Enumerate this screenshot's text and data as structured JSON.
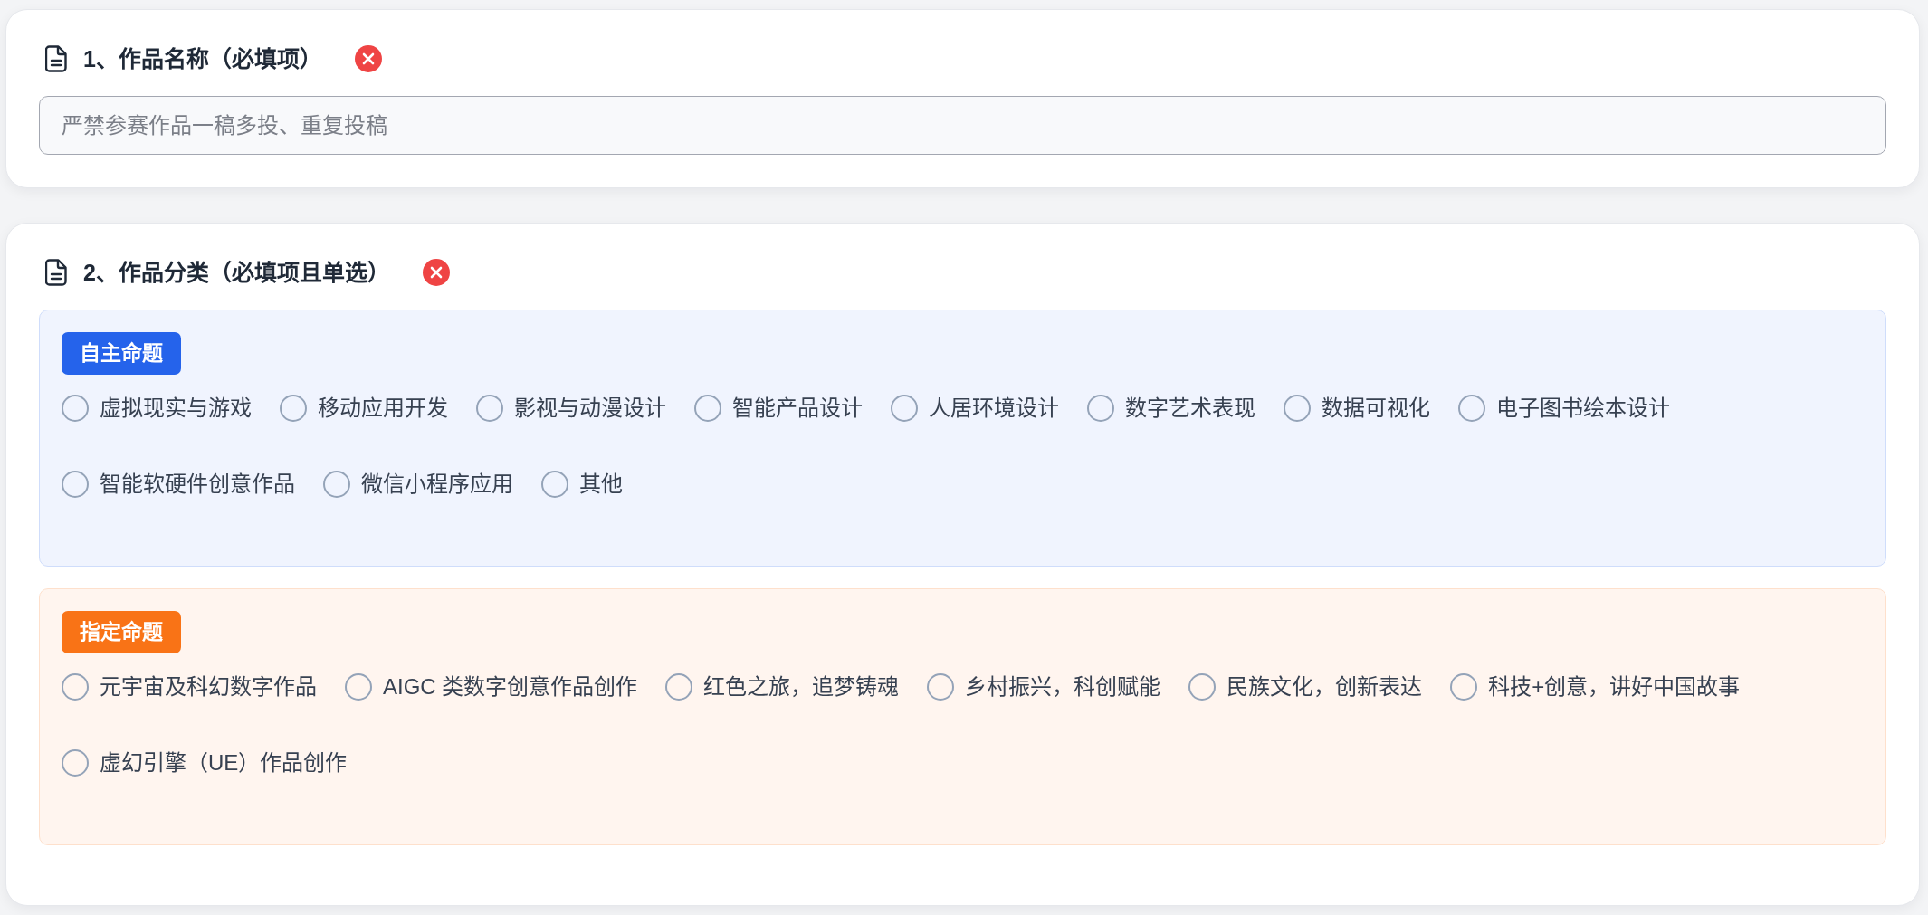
{
  "questions": [
    {
      "title": "1、作品名称（必填项）",
      "invalid": true,
      "kind": "text",
      "placeholder": "严禁参赛作品一稿多投、重复投稿"
    },
    {
      "title": "2、作品分类（必填项且单选）",
      "invalid": true,
      "kind": "radio_groups",
      "groups": [
        {
          "tag": "自主命题",
          "color": "#2563eb",
          "options": [
            {
              "label": "虚拟现实与游戏",
              "selected": false
            },
            {
              "label": "移动应用开发",
              "selected": false
            },
            {
              "label": "影视与动漫设计",
              "selected": false
            },
            {
              "label": "智能产品设计",
              "selected": false
            },
            {
              "label": "人居环境设计",
              "selected": false
            },
            {
              "label": "数字艺术表现",
              "selected": false
            },
            {
              "label": "数据可视化",
              "selected": false
            },
            {
              "label": "电子图书绘本设计",
              "selected": false
            },
            {
              "label": "智能软硬件创意作品",
              "selected": false
            },
            {
              "label": "微信小程序应用",
              "selected": false
            },
            {
              "label": "其他",
              "selected": false
            }
          ]
        },
        {
          "tag": "指定命题",
          "color": "#f97316",
          "options": [
            {
              "label": "元宇宙及科幻数字作品",
              "selected": false
            },
            {
              "label": "AIGC 类数字创意作品创作",
              "selected": false
            },
            {
              "label": "红色之旅，追梦铸魂",
              "selected": false
            },
            {
              "label": "乡村振兴，科创赋能",
              "selected": false
            },
            {
              "label": "民族文化，创新表达",
              "selected": false
            },
            {
              "label": "科技+创意，讲好中国故事",
              "selected": false
            },
            {
              "label": "虚幻引擎（UE）作品创作",
              "selected": false
            }
          ]
        }
      ]
    }
  ]
}
